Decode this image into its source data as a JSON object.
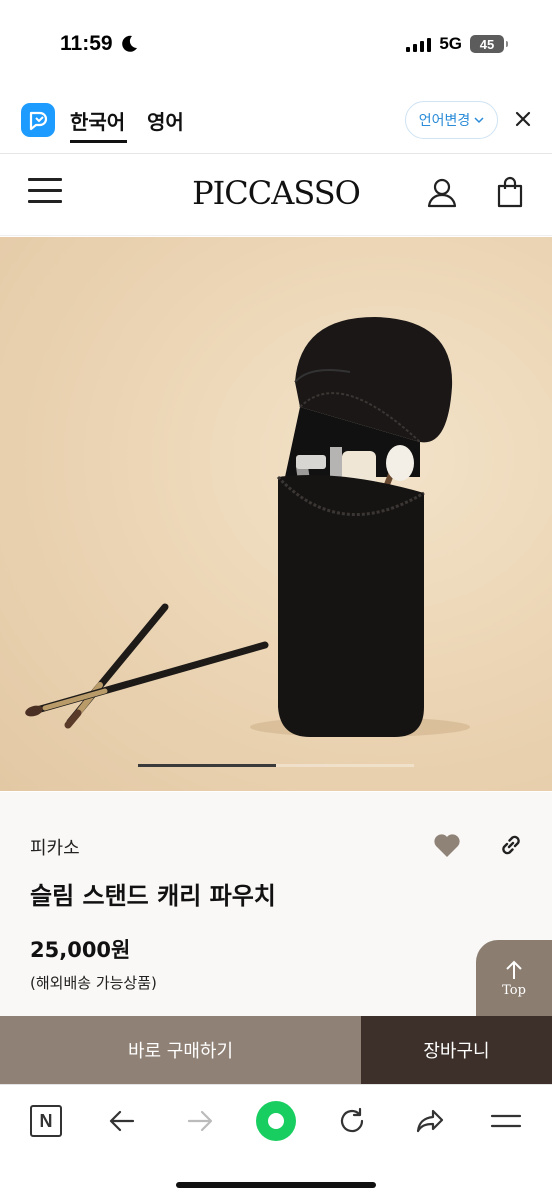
{
  "status_bar": {
    "time": "11:59",
    "network": "5G",
    "battery": "45"
  },
  "translate_bar": {
    "tabs": [
      {
        "label": "한국어",
        "active": true
      },
      {
        "label": "영어",
        "active": false
      }
    ],
    "change_language_label": "언어변경"
  },
  "header": {
    "brand": "PICCASSO"
  },
  "product_image": {
    "description_icon": "product-photo",
    "slide_progress": 0.5
  },
  "product": {
    "brand": "피카소",
    "title": "슬림 스탠드 캐리 파우치",
    "price": "25,000원",
    "shipping_note": "(해외배송 가능상품)",
    "liked_color": "#8f8377"
  },
  "top_button": {
    "label": "Top"
  },
  "actions": {
    "buy_now": "바로 구매하기",
    "cart": "장바구니",
    "buy_color": "#8f8175",
    "cart_color": "#3d302a"
  },
  "browser_bar": {
    "icons": [
      "naver-n-icon",
      "back-arrow-icon",
      "forward-arrow-icon",
      "green-home-icon",
      "reload-icon",
      "share-icon",
      "menu-icon"
    ],
    "accent": "#19ce60"
  }
}
